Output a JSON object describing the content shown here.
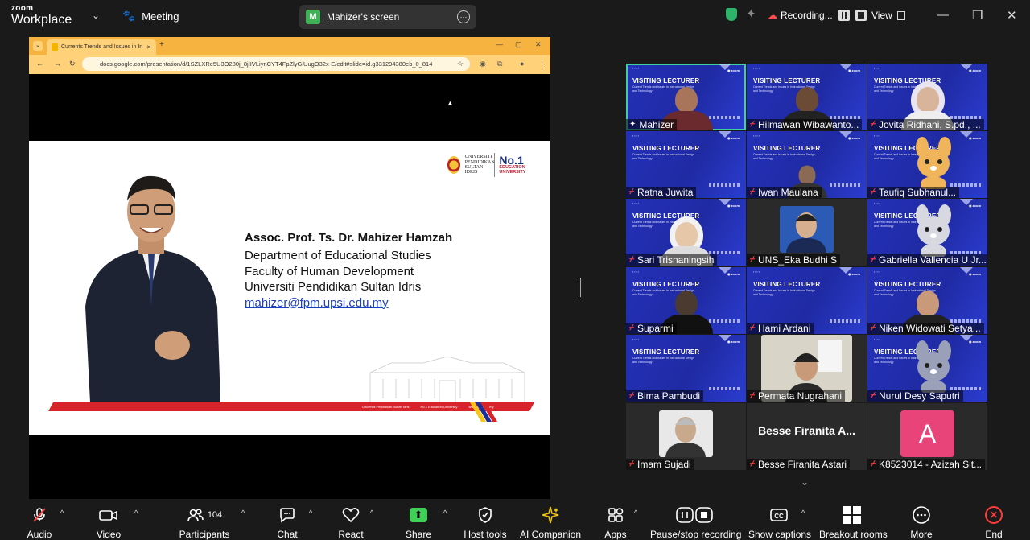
{
  "app": {
    "logo_line1": "zoom",
    "logo_line2": "Workplace",
    "meeting_label": "Meeting"
  },
  "screen_share": {
    "initial": "M",
    "label": "Mahizer's screen",
    "more": "···"
  },
  "recording": {
    "label": "Recording..."
  },
  "view": {
    "label": "View"
  },
  "browser": {
    "tab_title": "Currents Trends and Issues in In",
    "url": "docs.google.com/presentation/d/1SZLXRe5U3O280j_8jIIVLiynCYT4FpZlyGiUugO32x-E/edit#slide=id.g331294380eb_0_814"
  },
  "slide": {
    "logo_uni": "UNIVERSITI PENDIDIKAN SULTAN IDRIS",
    "logo_no1": "No.1",
    "logo_no1_sub": "EDUCATION UNIVERSITY",
    "name": "Assoc. Prof. Ts. Dr. Mahizer Hamzah",
    "lines": [
      "Department of Educational Studies",
      "Faculty of Human Development",
      "Universiti Pendidikan Sultan Idris"
    ],
    "email": "mahizer@fpm.upsi.edu.my",
    "footer": [
      "Universiti Pendidikan Sultan Idris",
      "No.1 Education University",
      "www.upsi.edu.my"
    ]
  },
  "tile_banner": {
    "title": "VISITING LECTURER",
    "subtitle": "Current Trends and Issues in Instructional Design and Technology",
    "logo": "zoom"
  },
  "participants": [
    {
      "name": "Mahizer",
      "muted": false,
      "pinned": true
    },
    {
      "name": "Hilmawan Wibawanto...",
      "muted": true
    },
    {
      "name": "Jovita Ridhani, S.pd., ...",
      "muted": true
    },
    {
      "name": "Ratna Juwita",
      "muted": true
    },
    {
      "name": "Iwan Maulana",
      "muted": true
    },
    {
      "name": "Taufiq Subhanul...",
      "muted": true
    },
    {
      "name": "Sari Trisnaningsih",
      "muted": true
    },
    {
      "name": "UNS_Eka Budhi S",
      "muted": true
    },
    {
      "name": "Gabriella Vallencia U Jr...",
      "muted": true
    },
    {
      "name": "Suparmi",
      "muted": true
    },
    {
      "name": "Hami Ardani",
      "muted": true
    },
    {
      "name": "Niken Widowati Setya...",
      "muted": true
    },
    {
      "name": "Bima Pambudi",
      "muted": true
    },
    {
      "name": "Permata Nugrahani",
      "muted": true
    },
    {
      "name": "Nurul Desy Saputri",
      "muted": true
    },
    {
      "name": "Imam Sujadi",
      "muted": true
    },
    {
      "name": "Besse Firanita Astari",
      "muted": true,
      "big": "Besse Firanita A..."
    },
    {
      "name": "K8523014 - Azizah Sit...",
      "muted": true,
      "avatar": "A"
    }
  ],
  "toolbar": {
    "audio": "Audio",
    "video": "Video",
    "participants": "Participants",
    "participants_count": "104",
    "chat": "Chat",
    "react": "React",
    "share": "Share",
    "host_tools": "Host tools",
    "ai_companion": "AI Companion",
    "apps": "Apps",
    "pause_stop_recording": "Pause/stop recording",
    "show_captions": "Show captions",
    "breakout_rooms": "Breakout rooms",
    "more": "More",
    "end": "End"
  },
  "colors": {
    "accent_green": "#3fd058",
    "mute_red": "#ff4040",
    "slide_blue": "#2431b8",
    "end_red": "#ff3b3b"
  }
}
